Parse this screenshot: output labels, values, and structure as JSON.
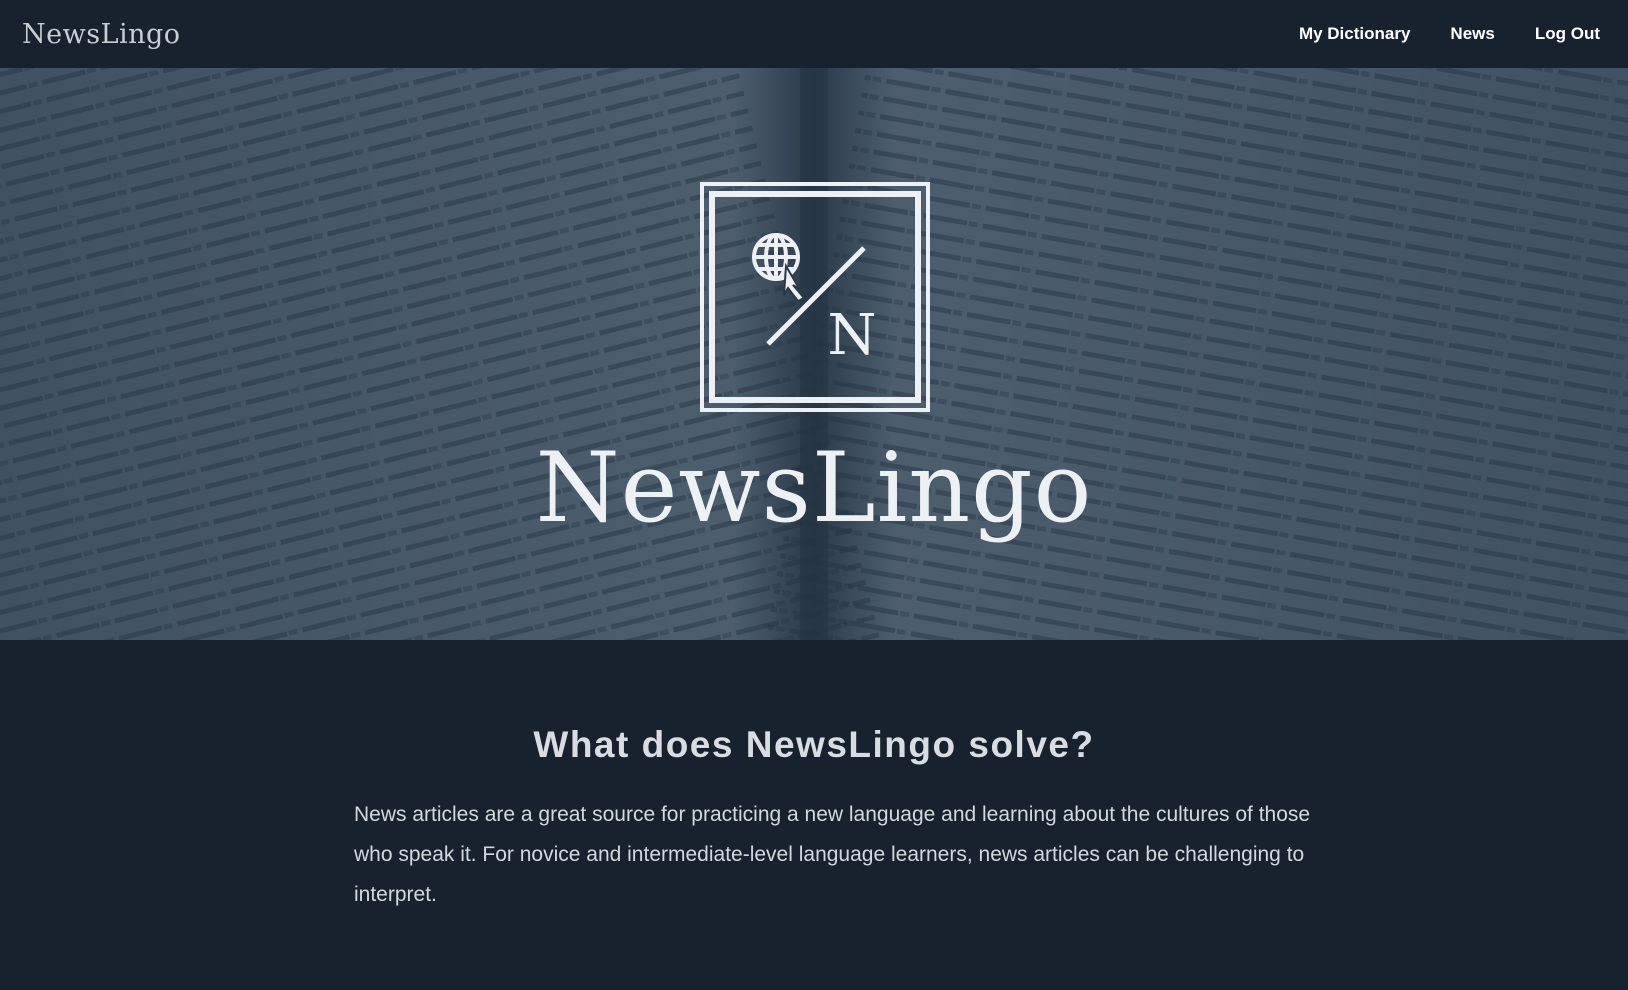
{
  "header": {
    "brand": "NewsLingo",
    "nav": [
      {
        "label": "My Dictionary"
      },
      {
        "label": "News"
      },
      {
        "label": "Log Out"
      }
    ]
  },
  "hero": {
    "title": "NewsLingo",
    "logo_letter": "N",
    "logo_icon": "globe-cursor-icon",
    "background": "open-dictionary-photo"
  },
  "section": {
    "heading": "What does NewsLingo solve?",
    "text": "News articles are a great source for practicing a new language and learning about the cultures of those who speak it. For novice and intermediate-level language learners, news articles can be challenging to interpret."
  },
  "colors": {
    "background": "#17222e",
    "overlay": "#1e3042",
    "text_light": "#d9dde2"
  }
}
